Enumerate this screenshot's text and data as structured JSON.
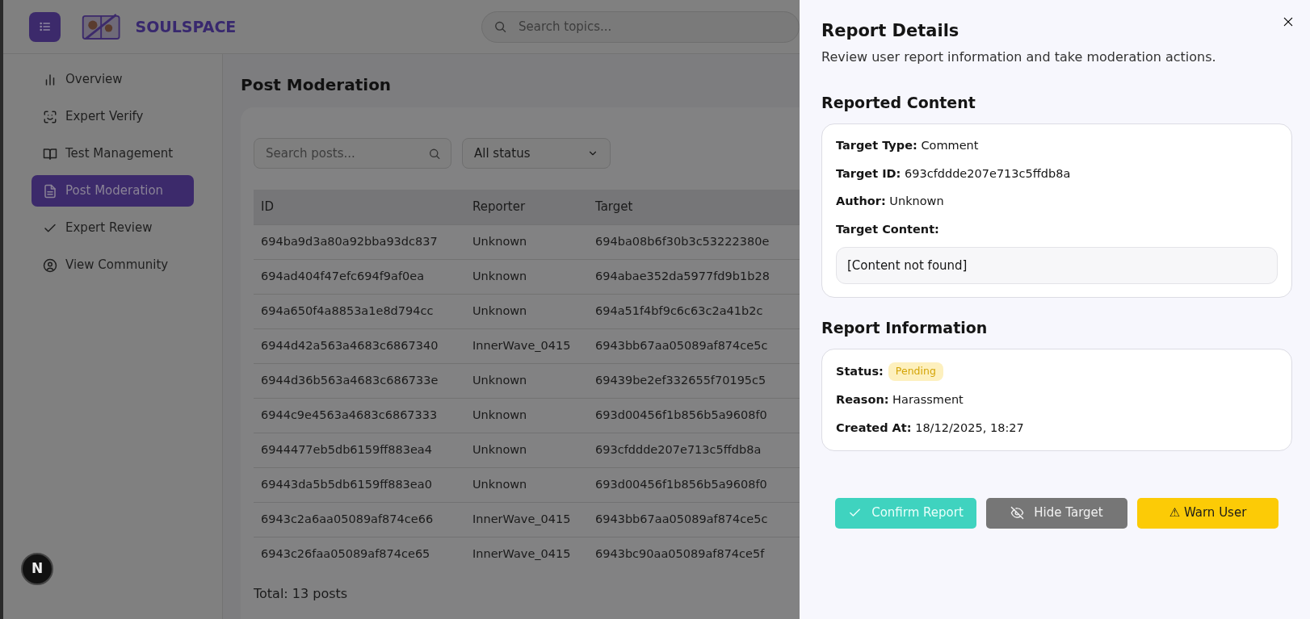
{
  "header": {
    "logo_text": "SOULSPACE",
    "search_placeholder": "Search topics..."
  },
  "sidebar": {
    "items": [
      {
        "label": "Overview",
        "kind": "chart",
        "selected": false
      },
      {
        "label": "Expert Verify",
        "kind": "scan",
        "selected": false
      },
      {
        "label": "Test Management",
        "kind": "book",
        "selected": false
      },
      {
        "label": "Post Moderation",
        "kind": "doc",
        "selected": true
      },
      {
        "label": "Expert Review",
        "kind": "check",
        "selected": false
      },
      {
        "label": "View Community",
        "kind": "user",
        "selected": false
      }
    ]
  },
  "page": {
    "title": "Post Moderation",
    "search_placeholder": "Search posts...",
    "status_filter": "All status",
    "table": {
      "columns": [
        "ID",
        "Reporter",
        "Target"
      ],
      "rows": [
        [
          "694ba9d3a80a92bba93dc837",
          "Unknown",
          "694ba08b6f30b3c53222380e"
        ],
        [
          "694ad404f47efc694f9af0ea",
          "Unknown",
          "694abae352da5977fd9b1b28"
        ],
        [
          "694a650f4a8853a1e8d794cc",
          "Unknown",
          "694a51f4bf9c6c63c2a41b2c"
        ],
        [
          "6944d42a563a4683c6867340",
          "InnerWave_0415",
          "6943bb67aa05089af874ce5c"
        ],
        [
          "6944d36b563a4683c686733e",
          "Unknown",
          "69439be2ef332655f70195c5"
        ],
        [
          "6944c9e4563a4683c6867333",
          "Unknown",
          "693d00456f1b856b5a9608f0"
        ],
        [
          "6944477eb5db6159ff883ea4",
          "Unknown",
          "693cfddde207e713c5ffdb8a"
        ],
        [
          "69443da5b5db6159ff883ea0",
          "Unknown",
          "693d00456f1b856b5a9608f0"
        ],
        [
          "6943c2a6aa05089af874ce66",
          "InnerWave_0415",
          "6943bb67aa05089af874ce5c"
        ],
        [
          "6943c26faa05089af874ce65",
          "InnerWave_0415",
          "6943bc90aa05089af874ce5f"
        ]
      ]
    },
    "total": "Total: 13 posts"
  },
  "floating_button": "N",
  "panel": {
    "title": "Report Details",
    "subtitle": "Review user report information and take moderation actions.",
    "reported_content": {
      "heading": "Reported Content",
      "fields": [
        {
          "label": "Target Type:",
          "value": "Comment"
        },
        {
          "label": "Target ID:",
          "value": "693cfddde207e713c5ffdb8a"
        },
        {
          "label": "Author:",
          "value": "Unknown"
        }
      ],
      "content_label": "Target Content:",
      "content": "[Content not found]"
    },
    "report_information": {
      "heading": "Report Information",
      "status_label": "Status:",
      "status": "Pending",
      "fields": [
        {
          "label": "Reason:",
          "value": "Harassment"
        },
        {
          "label": "Created At:",
          "value": "18/12/2025, 18:27"
        }
      ]
    },
    "actions": [
      {
        "label": "Confirm Report",
        "kind": "confirm"
      },
      {
        "label": "Hide Target",
        "kind": "hide"
      },
      {
        "label": "⚠ Warn User",
        "kind": "warn"
      }
    ]
  }
}
